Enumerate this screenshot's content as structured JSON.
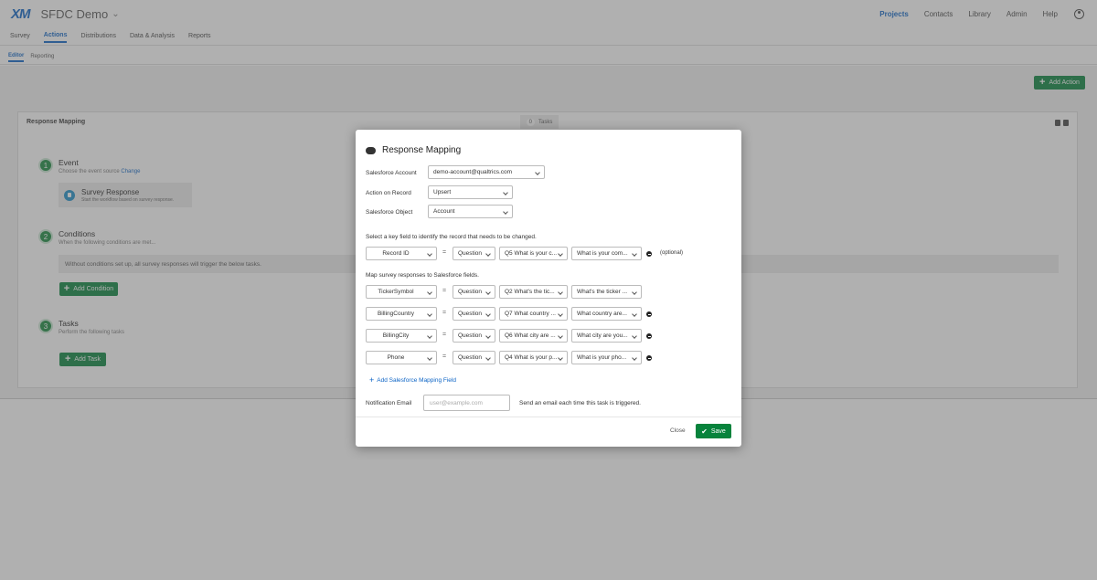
{
  "app": {
    "logo": "XM",
    "project": "SFDC Demo",
    "project_caret": "⌄"
  },
  "topnav": [
    "Projects",
    "Contacts",
    "Library",
    "Admin",
    "Help"
  ],
  "tabs": [
    "Survey",
    "Actions",
    "Distributions",
    "Data & Analysis",
    "Reports"
  ],
  "subtabs": [
    "Editor",
    "Reporting"
  ],
  "toolbar": {
    "add_action": "Add Action"
  },
  "action_card": {
    "title": "Response Mapping",
    "task_count": "0",
    "tasks_label": "Tasks",
    "event": {
      "num": "1",
      "title": "Event",
      "sub": "Choose the event source",
      "change": "Change",
      "source_title": "Survey Response",
      "source_sub": "Start the workflow based on survey response."
    },
    "conditions": {
      "num": "2",
      "title": "Conditions",
      "sub": "When the following conditions are met...",
      "empty_text": "Without conditions set up, all survey responses will trigger the below tasks.",
      "add_label": "Add Condition"
    },
    "tasks": {
      "num": "3",
      "title": "Tasks",
      "sub": "Perform the following tasks",
      "add_label": "Add Task"
    }
  },
  "modal": {
    "title": "Response Mapping",
    "account_label": "Salesforce Account",
    "account_value": "demo-account@qualtrics.com",
    "action_label": "Action on Record",
    "action_value": "Upsert",
    "object_label": "Salesforce Object",
    "object_value": "Account",
    "key_instruction": "Select a key field to identify the record that needs to be changed.",
    "key_row": {
      "field": "Record ID",
      "eq": "=",
      "type": "Question",
      "question": "Q5 What is your c...",
      "answer": "What is your com...",
      "optional": "(optional)"
    },
    "map_instruction": "Map survey responses to Salesforce fields.",
    "map_rows": [
      {
        "field": "TickerSymbol",
        "eq": "=",
        "type": "Question",
        "question": "Q2 What's the tic...",
        "answer": "What's the ticker ..."
      },
      {
        "field": "BillingCountry",
        "eq": "=",
        "type": "Question",
        "question": "Q7 What country ...",
        "answer": "What country are..."
      },
      {
        "field": "BillingCity",
        "eq": "=",
        "type": "Question",
        "question": "Q6 What city are ...",
        "answer": "What city are you..."
      },
      {
        "field": "Phone",
        "eq": "=",
        "type": "Question",
        "question": "Q4 What is your p...",
        "answer": "What is your pho..."
      }
    ],
    "add_mapping": "Add Salesforce Mapping Field",
    "email_label": "Notification Email",
    "email_placeholder": "user@example.com",
    "email_note": "Send an email each time this task is triggered.",
    "close_label": "Close",
    "save_label": "Save"
  }
}
